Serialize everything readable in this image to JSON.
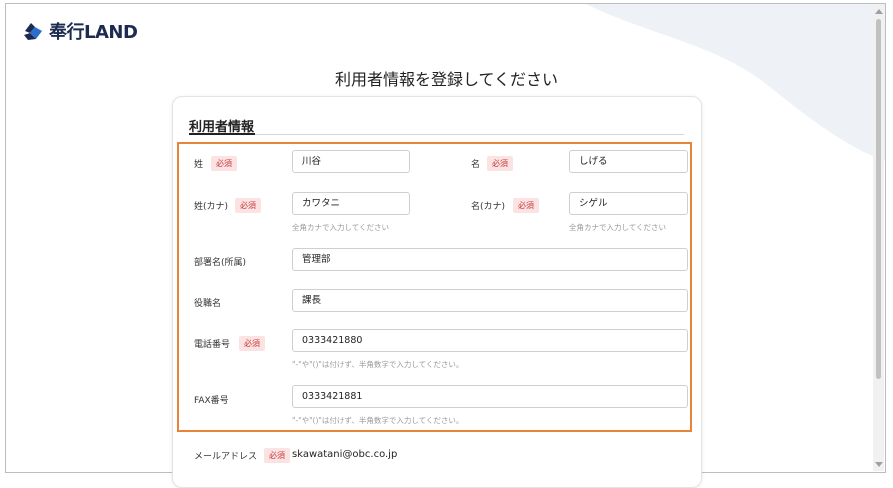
{
  "header": {
    "logo_text": "奉行LAND"
  },
  "page": {
    "title": "利用者情報を登録してください"
  },
  "section": {
    "title": "利用者情報"
  },
  "required_label": "必須",
  "fields": {
    "last_name": {
      "label": "姓",
      "value": "川谷"
    },
    "first_name": {
      "label": "名",
      "value": "しげる"
    },
    "last_name_kana": {
      "label": "姓(カナ)",
      "value": "カワタニ",
      "hint": "全角カナで入力してください"
    },
    "first_name_kana": {
      "label": "名(カナ)",
      "value": "シゲル",
      "hint": "全角カナで入力してください"
    },
    "department": {
      "label": "部署名(所属)",
      "value": "管理部"
    },
    "position": {
      "label": "役職名",
      "value": "課長"
    },
    "phone": {
      "label": "電話番号",
      "value": "0333421880",
      "hint": "\"-\"や\"()\"は付けず、半角数字で入力してください。"
    },
    "fax": {
      "label": "FAX番号",
      "value": "0333421881",
      "hint": "\"-\"や\"()\"は付けず、半角数字で入力してください。"
    },
    "email": {
      "label": "メールアドレス",
      "value": "skawatani@obc.co.jp"
    }
  },
  "colors": {
    "accent_highlight": "#e8843a",
    "required": "#c83a3a",
    "logo": "#1c2b50"
  }
}
